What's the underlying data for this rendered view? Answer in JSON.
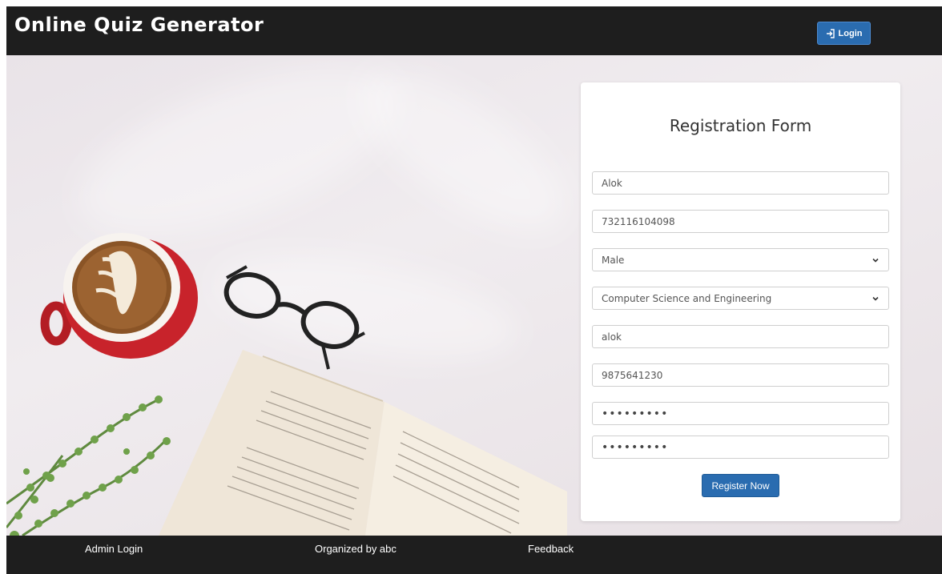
{
  "header": {
    "brand": "Online Quiz Generator",
    "login_label": "Login"
  },
  "form": {
    "title": "Registration Form",
    "name_value": "Alok",
    "id_value": "732116104098",
    "gender_selected": "Male",
    "department_selected": "Computer Science and Engineering",
    "username_value": "alok",
    "phone_value": "9875641230",
    "password_mask": "•••••••••",
    "confirm_password_mask": "•••••••••",
    "submit_label": "Register Now"
  },
  "footer": {
    "admin_login": "Admin Login",
    "organized_by": "Organized by abc",
    "feedback": "Feedback"
  },
  "colors": {
    "header_bg": "#1e1e1e",
    "primary_button": "#2a6cb0",
    "mug_red": "#c8232b"
  },
  "icons": [
    "sign-in-icon",
    "chevron-down-icon"
  ]
}
